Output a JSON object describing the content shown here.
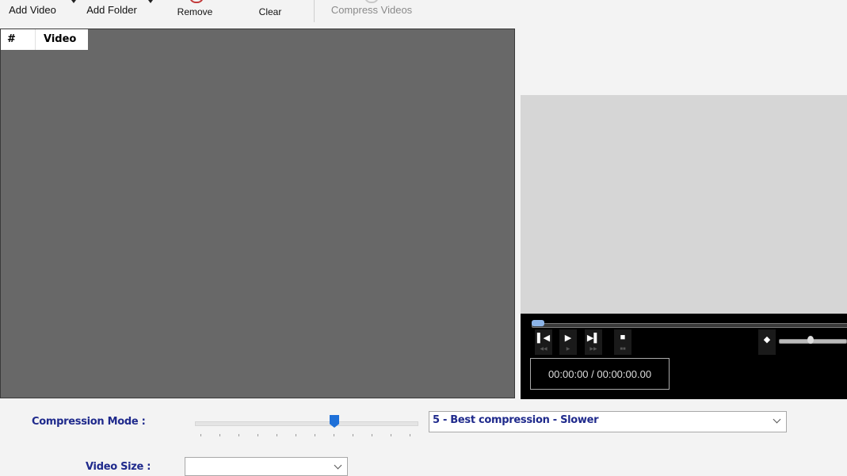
{
  "toolbar": {
    "add_video": "Add Video",
    "add_folder": "Add Folder",
    "remove": "Remove",
    "clear": "Clear",
    "compress_videos": "Compress Videos"
  },
  "video_list": {
    "columns": [
      "#",
      "Video"
    ]
  },
  "player": {
    "time": "00:00:00 / 00:00:00.00",
    "seek_position": 0,
    "volume_level": 0.5
  },
  "settings": {
    "compression_mode_label": "Compression Mode :",
    "compression_mode_value": "5 - Best compression - Slower",
    "compression_slider_value": 5,
    "video_size_label": "Video Size :",
    "video_size_value": ""
  },
  "colors": {
    "label_blue": "#1f2a8c",
    "list_bg": "#686868",
    "slider_thumb": "#1e70d8"
  }
}
